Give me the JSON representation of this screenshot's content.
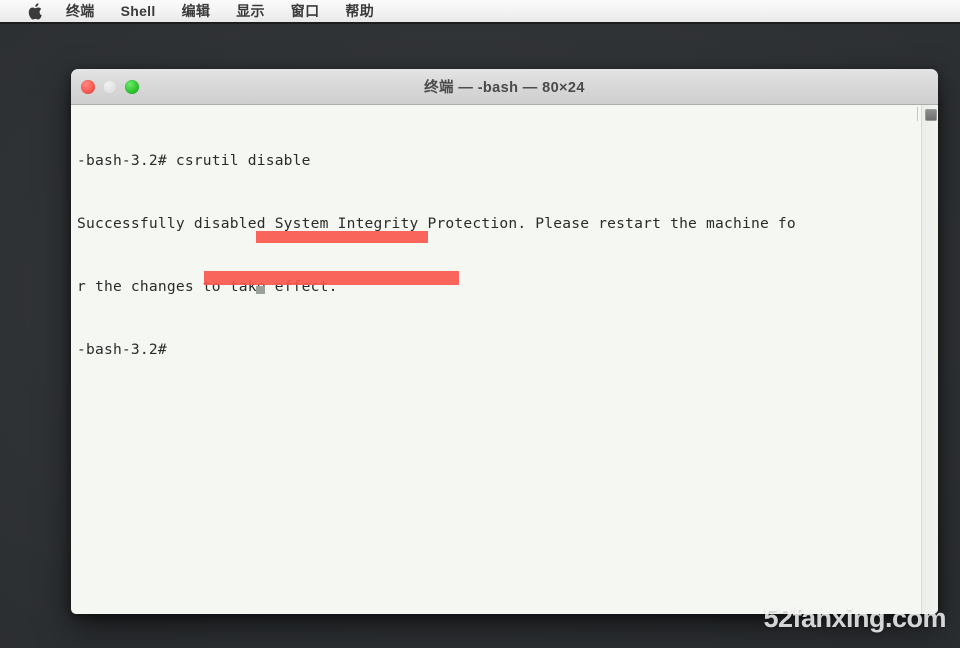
{
  "menubar": {
    "apple_icon": "apple-logo-icon",
    "items": [
      {
        "id": "terminal",
        "label": "终端"
      },
      {
        "id": "shell",
        "label": "Shell"
      },
      {
        "id": "edit",
        "label": "编辑"
      },
      {
        "id": "view",
        "label": "显示"
      },
      {
        "id": "window",
        "label": "窗口"
      },
      {
        "id": "help",
        "label": "帮助"
      }
    ]
  },
  "window": {
    "title": "终端 — -bash — 80×24",
    "controls": {
      "close": "close-button",
      "minimize": "minimize-button",
      "zoom": "zoom-button"
    }
  },
  "terminal": {
    "lines": [
      "-bash-3.2# csrutil disable",
      "Successfully disabled System Integrity Protection. Please restart the machine fo",
      "r the changes to take effect.",
      "-bash-3.2# "
    ],
    "prompt": "-bash-3.2#",
    "command": "csrutil disable",
    "cursor": "block-cursor",
    "redactions": [
      {
        "id": "redaction-1",
        "covers": "ly disabled Syste"
      },
      {
        "id": "redaction-2",
        "covers": "-3.2#"
      }
    ]
  },
  "scrollbar": {
    "thumb": "scroll-thumb"
  },
  "watermark": {
    "text": "52fanxing.com"
  },
  "colors": {
    "desktop_bg": "#2f3235",
    "menubar_bg": "#f2f2f2",
    "titlebar_bg": "#d8d8d8",
    "terminal_bg": "#f4f7f2",
    "terminal_text": "#2b2b2b",
    "redaction_red": "#f8584e",
    "traffic_close": "#fb5b52",
    "traffic_minimize": "#e2e2e2",
    "traffic_zoom": "#2ec82e",
    "watermark": "#ffffff"
  }
}
